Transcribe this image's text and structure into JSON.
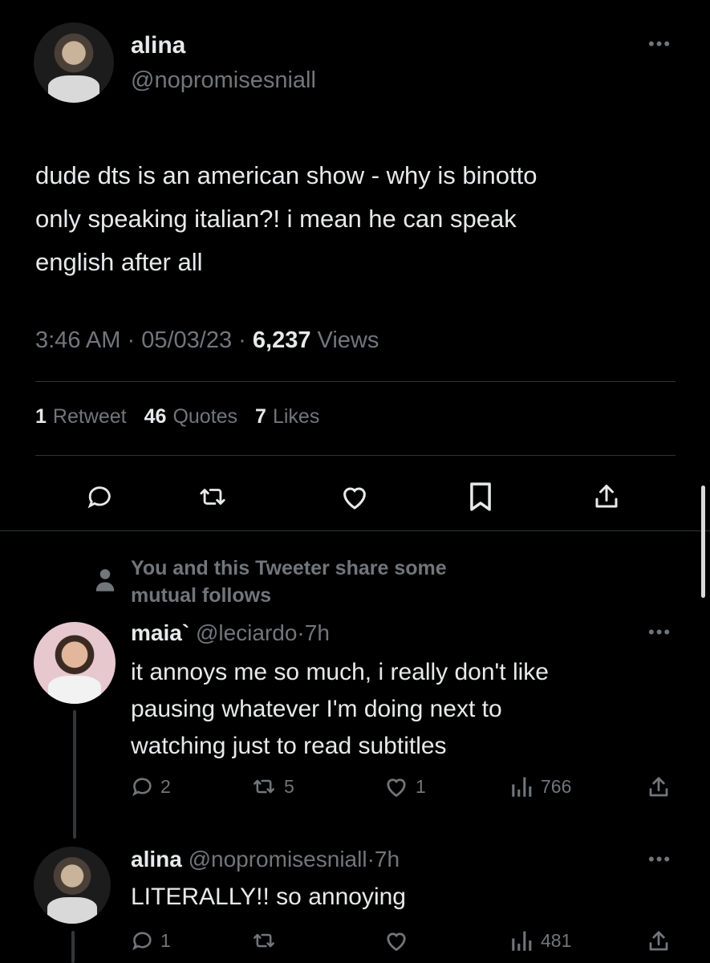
{
  "main_tweet": {
    "display_name": "alina",
    "handle": "@nopromisesniall",
    "text_lines": [
      "dude dts is an american show - why is binotto",
      "only speaking italian?! i mean he can speak",
      "english after all"
    ],
    "time": "3:46 AM",
    "date": "05/03/23",
    "views_count": "6,237",
    "views_label": "Views",
    "retweets_count": "1",
    "retweets_label": "Retweet",
    "quotes_count": "46",
    "quotes_label": "Quotes",
    "likes_count": "7",
    "likes_label": "Likes"
  },
  "mutual_notice": {
    "line1": "You and this Tweeter share some",
    "line2": "mutual follows"
  },
  "replies": [
    {
      "display_name": "maia`",
      "handle": "@leciardo",
      "time": "7h",
      "text_lines": [
        "it annoys me so much, i really don't like",
        "pausing whatever I'm doing next to",
        "watching just to read subtitles"
      ],
      "reply_count": "2",
      "retweet_count": "5",
      "like_count": "1",
      "views": "766"
    },
    {
      "display_name": "alina",
      "handle": "@nopromisesniall",
      "time": "7h",
      "text_lines": [
        "LITERALLY!! so annoying"
      ],
      "reply_count": "1",
      "views": "481"
    }
  ],
  "separator": "·",
  "colors": {
    "background": "#000000",
    "text": "#e7e9ea",
    "muted": "#71767b",
    "divider": "#2f3336"
  }
}
